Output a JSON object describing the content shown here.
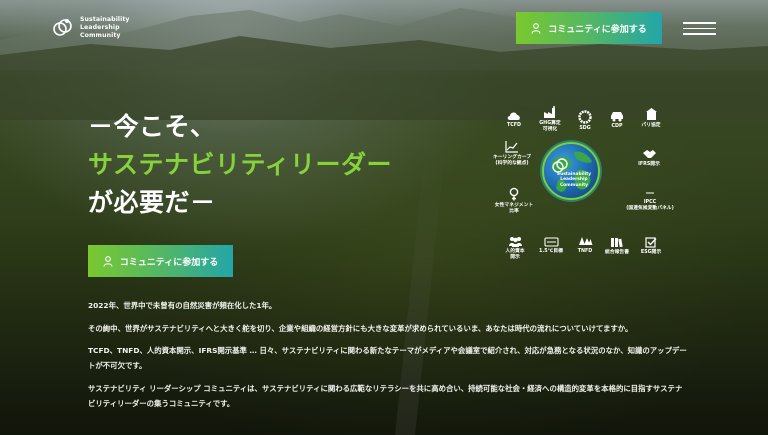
{
  "header": {
    "logo_lines": [
      "Sustainability",
      "Leadership",
      "Community"
    ],
    "cta_label": "コミュニティに参加する",
    "menu_icon": "hamburger-menu-icon"
  },
  "hero": {
    "line1": "－今こそ、",
    "line2": "サステナビリティリーダー",
    "line3": "が必要だ－",
    "cta_label": "コミュニティに参加する",
    "accent_color": "#86d23b"
  },
  "paragraphs": [
    "2022年、世界中で未曾有の自然災害が頻在化した1年。",
    "その絢中、世界がサステナビリティへと大きく舵を切り、企業や組織の経営方針にも大きな変革が求められているいま、あなたは時代の流れについていけてますか。",
    "TCFD、TNFD、人的資本開示、IFRS開示基準 … 日々、サステナビリティに関わる新たなテーマがメディアや会議室で紹介され、対応が急務となる状況のなか、知識のアップデートが不可欠です。",
    "サステナビリティ リーダーシップ コミュニティは、サステナビリティに関わる広範なリテラシーを共に高め合い、持続可能な社会・経済への構造的変革を本格的に目指すサステナビリティリーダーの集うコミュニティです。"
  ],
  "diagram": {
    "center_lines": [
      "Sustainability",
      "Leadership",
      "Community"
    ],
    "items": [
      {
        "label": [
          "TCFD"
        ],
        "icon": "cloud-icon"
      },
      {
        "label": [
          "GHG算定",
          "可視化"
        ],
        "icon": "factory-icon"
      },
      {
        "label": [
          "SDG"
        ],
        "icon": "sdg-wheel-icon"
      },
      {
        "label": [
          "CDP"
        ],
        "icon": "car-icon"
      },
      {
        "label": [
          "パリ協定"
        ],
        "icon": "building-icon"
      },
      {
        "label": [
          "キーリングカーブ",
          "(科学的な観点)"
        ],
        "icon": "line-graph-icon"
      },
      {
        "label": [
          "IFRS開示"
        ],
        "icon": "handshake-icon"
      },
      {
        "label": [
          "女性マネジメント",
          "比率"
        ],
        "icon": "female-icon"
      },
      {
        "label": [
          "IPCC",
          "(国連気候変動パネル)"
        ],
        "icon": "ipcc-icon"
      },
      {
        "label": [
          "人的資本",
          "開示"
        ],
        "icon": "people-icon"
      },
      {
        "label": [
          "1.5℃目標"
        ],
        "icon": "thermometer-icon"
      },
      {
        "label": [
          "TNFD"
        ],
        "icon": "trees-icon"
      },
      {
        "label": [
          "統合報告書"
        ],
        "icon": "books-icon"
      },
      {
        "label": [
          "ESG開示"
        ],
        "icon": "checkbox-icon"
      }
    ]
  }
}
